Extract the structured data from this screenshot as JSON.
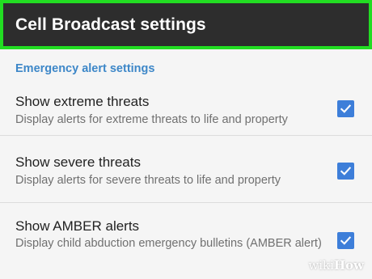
{
  "app_bar": {
    "title": "Cell Broadcast settings"
  },
  "section": {
    "header": "Emergency alert settings"
  },
  "preferences": [
    {
      "title": "Show extreme threats",
      "summary": "Display alerts for extreme threats to life and property",
      "checked": true
    },
    {
      "title": "Show severe threats",
      "summary": "Display alerts for severe threats to life and property",
      "checked": true
    },
    {
      "title": "Show AMBER alerts",
      "summary": "Display child abduction emergency bulletins (AMBER alert)",
      "checked": true
    }
  ],
  "watermark": {
    "part1": "wiki",
    "part2": "How"
  },
  "colors": {
    "app_bar": "#2d2d2d",
    "highlight_border": "#22dd22",
    "accent": "#3d87c8",
    "checkbox": "#3d7ed9"
  }
}
